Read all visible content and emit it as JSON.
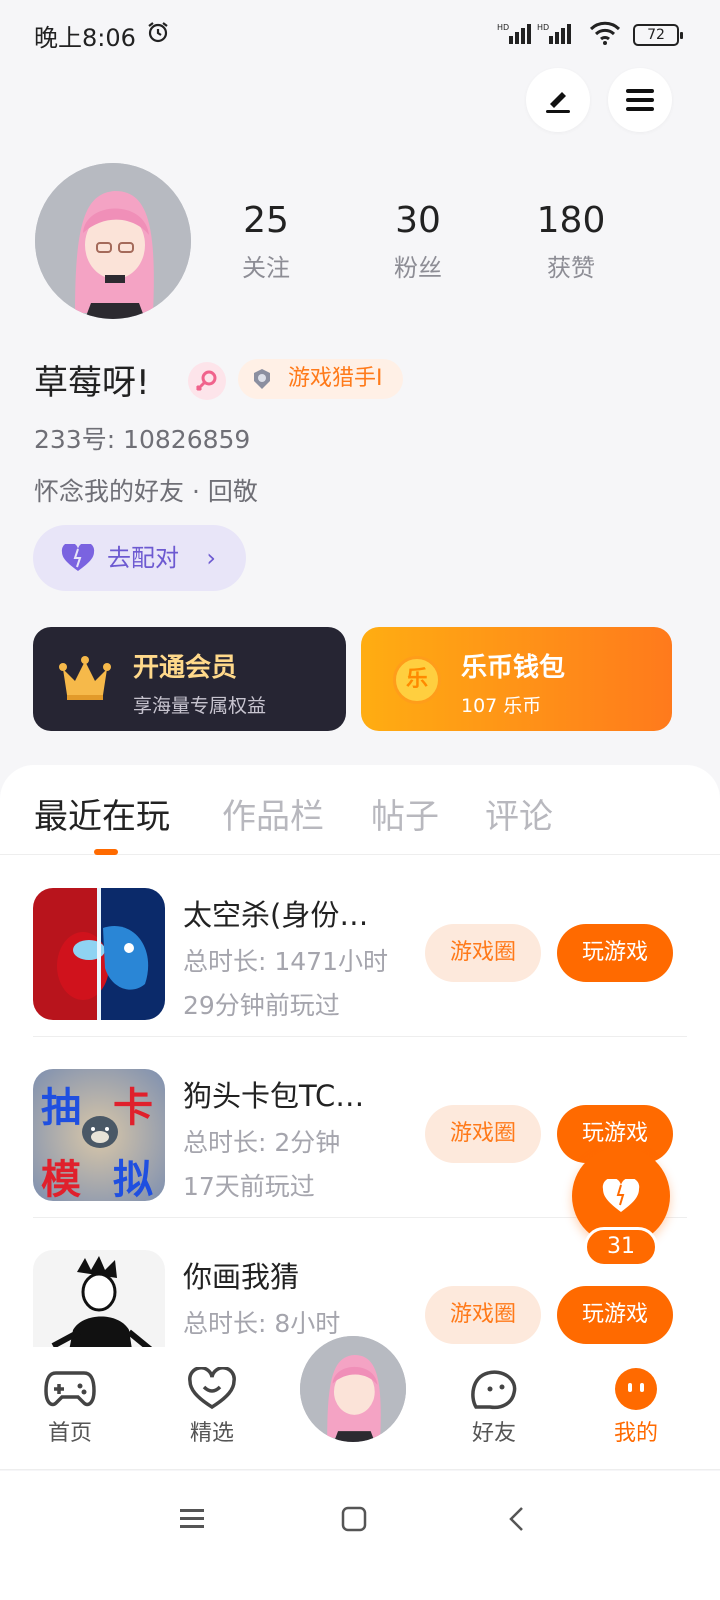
{
  "status_bar": {
    "time": "晚上8:06",
    "battery": "72"
  },
  "profile": {
    "stats": [
      {
        "value": "25",
        "label": "关注"
      },
      {
        "value": "30",
        "label": "粉丝"
      },
      {
        "value": "180",
        "label": "获赞"
      }
    ],
    "name": "草莓呀!",
    "badge": "游戏猎手Ⅰ",
    "uid": "233号: 10826859",
    "signature": "怀念我的好友 · 回敬",
    "match_button": "去配对"
  },
  "cards": {
    "vip": {
      "title": "开通会员",
      "subtitle": "享海量专属权益"
    },
    "coin": {
      "title": "乐币钱包",
      "subtitle": "107 乐币",
      "icon_text": "乐"
    }
  },
  "tabs": [
    "最近在玩",
    "作品栏",
    "帖子",
    "评论"
  ],
  "games": [
    {
      "name": "太空杀(身份…",
      "duration": "总时长: 1471小时",
      "last_played": "29分钟前玩过",
      "circle_label": "游戏圈",
      "play_label": "玩游戏"
    },
    {
      "name": "狗头卡包TC…",
      "duration": "总时长: 2分钟",
      "last_played": "17天前玩过",
      "circle_label": "游戏圈",
      "play_label": "玩游戏",
      "icon_text": [
        "抽",
        "卡",
        "模",
        "拟"
      ]
    },
    {
      "name": "你画我猜",
      "duration": "总时长: 8小时",
      "last_played": "",
      "circle_label": "游戏圈",
      "play_label": "玩游戏"
    }
  ],
  "like_count": "31",
  "bottom_nav": [
    {
      "label": "首页"
    },
    {
      "label": "精选"
    },
    {
      "label": "好友"
    },
    {
      "label": "我的"
    }
  ],
  "colors": {
    "accent": "#ff6a00",
    "vip_bg": "#262533",
    "match_bg": "#e8e5f8"
  }
}
